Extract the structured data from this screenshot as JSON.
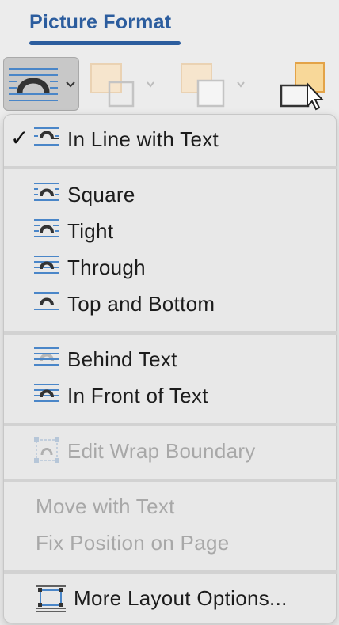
{
  "ribbon": {
    "tab_label": "Picture Format",
    "icons": [
      "wrap-text-icon",
      "chevron-down-icon",
      "position-icon",
      "bring-forward-icon",
      "selection-pane-icon"
    ]
  },
  "menu": {
    "sections": [
      {
        "items": [
          {
            "label": "In Line with Text",
            "checked": true,
            "icon": "wrap-inline-icon"
          }
        ]
      },
      {
        "items": [
          {
            "label": "Square",
            "icon": "wrap-square-icon"
          },
          {
            "label": "Tight",
            "icon": "wrap-tight-icon"
          },
          {
            "label": "Through",
            "icon": "wrap-through-icon"
          },
          {
            "label": "Top and Bottom",
            "icon": "wrap-top-bottom-icon"
          }
        ]
      },
      {
        "items": [
          {
            "label": "Behind Text",
            "icon": "wrap-behind-icon"
          },
          {
            "label": "In Front of Text",
            "icon": "wrap-front-icon"
          }
        ]
      },
      {
        "items": [
          {
            "label": "Edit Wrap Boundary",
            "disabled": true,
            "icon": "edit-boundary-icon"
          }
        ]
      },
      {
        "items": [
          {
            "label": "Move with Text",
            "disabled": true
          },
          {
            "label": "Fix Position on Page",
            "disabled": true
          }
        ]
      },
      {
        "items": [
          {
            "label": "More Layout Options...",
            "icon": "layout-options-icon"
          }
        ]
      }
    ]
  },
  "colors": {
    "accent": "#2c5d9e",
    "icon_line": "#4a86c8",
    "disabled": "#a8a8a8"
  }
}
